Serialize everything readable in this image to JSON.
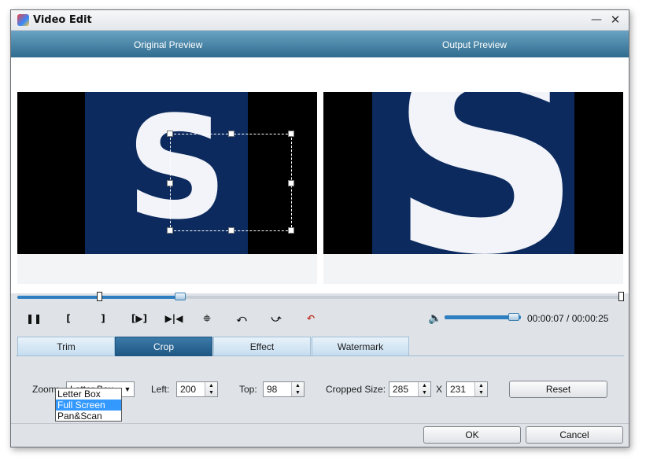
{
  "window": {
    "title": "Video Edit",
    "minimize_glyph": "—",
    "close_glyph": "✕"
  },
  "preview": {
    "original_label": "Original Preview",
    "output_label": "Output Preview",
    "letter": "S"
  },
  "timeline": {
    "progress": 0.27,
    "current": "00:00:07",
    "total": "00:00:25",
    "display": "00:00:07 / 00:00:25"
  },
  "controls": {
    "pause": "❚❚",
    "mark_in": "[",
    "mark_out": "]",
    "play_segment": "[▶]",
    "next_frame": "▶|◀",
    "split": "⯐",
    "rotate_left": "⤺",
    "rotate_right": "⤻",
    "undo": "↶",
    "speaker": "🔈",
    "volume": 0.9
  },
  "tabs": [
    {
      "label": "Trim",
      "active": false
    },
    {
      "label": "Crop",
      "active": true
    },
    {
      "label": "Effect",
      "active": false
    },
    {
      "label": "Watermark",
      "active": false
    }
  ],
  "crop": {
    "zoom_label": "Zoom:",
    "zoom_value": "Letter Box",
    "zoom_options": [
      "Letter Box",
      "Full Screen",
      "Pan&Scan"
    ],
    "zoom_highlighted": "Full Screen",
    "left_label": "Left:",
    "left_value": "200",
    "top_label": "Top:",
    "top_value": "98",
    "cropped_size_label": "Cropped Size:",
    "width_value": "285",
    "x_label": "X",
    "height_value": "231",
    "reset_label": "Reset"
  },
  "footer": {
    "ok_label": "OK",
    "cancel_label": "Cancel"
  },
  "colors": {
    "accent": "#2d7fc1",
    "header": "#2f6c8f",
    "video_bg": "#0c2a5e",
    "selected": "#3399ff"
  }
}
